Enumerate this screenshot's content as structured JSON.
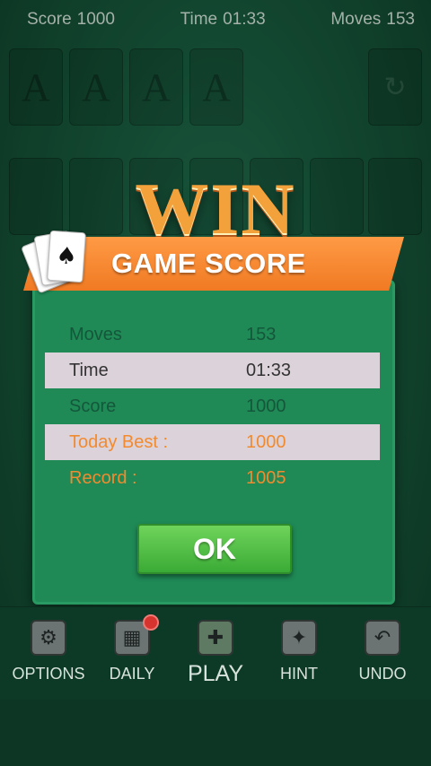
{
  "status": {
    "score_label": "Score",
    "score_value": "1000",
    "time_label": "Time",
    "time_value": "01:33",
    "moves_label": "Moves",
    "moves_value": "153"
  },
  "foundations": [
    "A",
    "A",
    "A",
    "A"
  ],
  "recycle_icon": "refresh-icon",
  "dialog": {
    "title": "WIN",
    "banner": "GAME SCORE",
    "rows": [
      {
        "label": "Moves",
        "value": "153"
      },
      {
        "label": "Time",
        "value": "01:33"
      },
      {
        "label": "Score",
        "value": "1000"
      },
      {
        "label": "Today Best :",
        "value": "1000"
      },
      {
        "label": "Record :",
        "value": "1005"
      }
    ],
    "ok_label": "OK"
  },
  "toolbar": {
    "items": [
      {
        "label": "OPTIONS",
        "icon": "gear-icon"
      },
      {
        "label": "DAILY",
        "icon": "calendar-icon"
      },
      {
        "label": "PLAY",
        "icon": "gamepad-icon"
      },
      {
        "label": "HINT",
        "icon": "lightbulb-icon"
      },
      {
        "label": "UNDO",
        "icon": "undo-icon"
      }
    ]
  },
  "colors": {
    "felt": "#1a6345",
    "banner": "#f28a2f",
    "panel": "#1f8a56",
    "ok": "#4cbf3d",
    "badge": "#d8342f"
  }
}
